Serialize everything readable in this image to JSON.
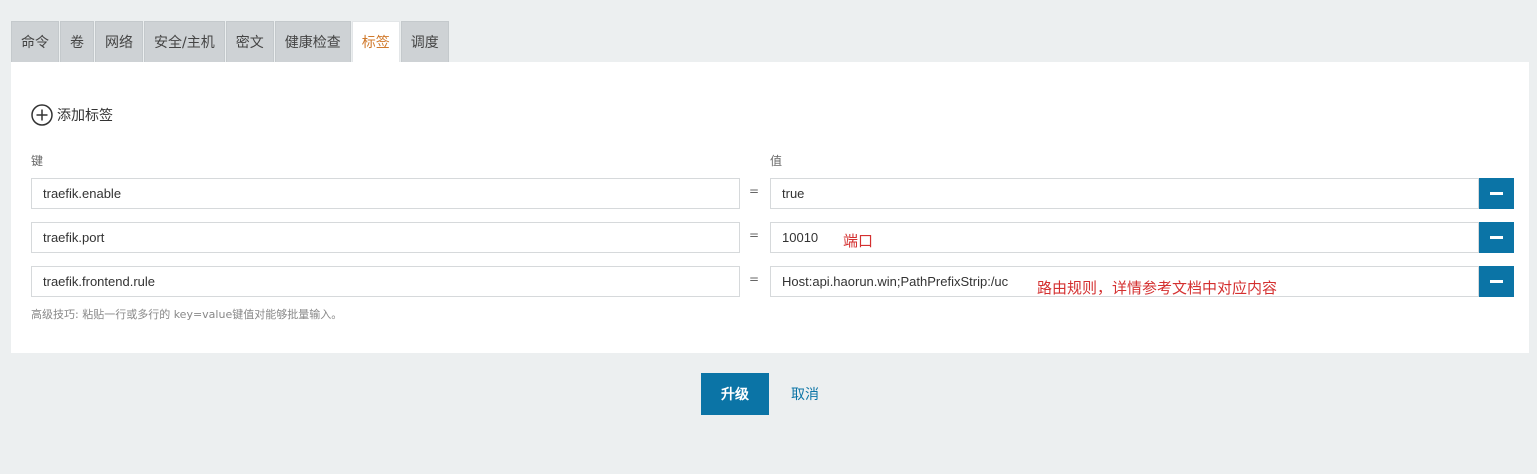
{
  "tabs": [
    {
      "label": "命令"
    },
    {
      "label": "卷"
    },
    {
      "label": "网络"
    },
    {
      "label": "安全/主机"
    },
    {
      "label": "密文"
    },
    {
      "label": "健康检查"
    },
    {
      "label": "标签",
      "active": true
    },
    {
      "label": "调度"
    }
  ],
  "labels_panel": {
    "add_label": "添加标签",
    "key_header": "键",
    "value_header": "值",
    "equals": "=",
    "rows": [
      {
        "key": "traefik.enable",
        "value": "true"
      },
      {
        "key": "traefik.port",
        "value": "10010"
      },
      {
        "key": "traefik.frontend.rule",
        "value": "Host:api.haorun.win;PathPrefixStrip:/uc"
      }
    ],
    "tip": "高级技巧: 粘贴一行或多行的 key=value键值对能够批量输入。"
  },
  "annotations": {
    "port_note": "端口",
    "rule_note": "路由规则，详情参考文档中对应内容"
  },
  "footer": {
    "upgrade_label": "升级",
    "cancel_label": "取消"
  },
  "colors": {
    "accent": "#0b74a6",
    "active_tab": "#d0792b",
    "annotation": "#d43030"
  },
  "icons": {
    "add": "plus-circle-icon",
    "remove": "minus-icon"
  }
}
